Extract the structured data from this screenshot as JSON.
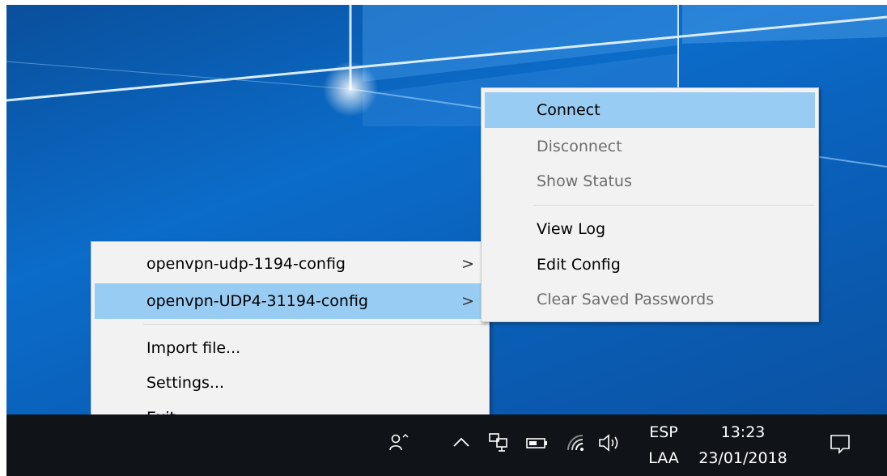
{
  "config_menu": {
    "items": [
      {
        "label": "openvpn-udp-1194-config",
        "has_submenu": true
      },
      {
        "label": "openvpn-UDP4-31194-config",
        "has_submenu": true,
        "highlighted": true
      }
    ],
    "actions": [
      {
        "label": "Import file..."
      },
      {
        "label": "Settings..."
      },
      {
        "label": "Exit"
      }
    ],
    "submenu_arrow": ">"
  },
  "submenu": {
    "items": [
      {
        "label": "Connect",
        "enabled": true,
        "highlighted": true
      },
      {
        "label": "Disconnect",
        "enabled": false
      },
      {
        "label": "Show Status",
        "enabled": false
      },
      {
        "label": "View Log",
        "enabled": true
      },
      {
        "label": "Edit Config",
        "enabled": true
      },
      {
        "label": "Clear Saved Passwords",
        "enabled": false
      }
    ]
  },
  "taskbar": {
    "language_top": "ESP",
    "language_bottom": "LAA",
    "time": "13:23",
    "date": "23/01/2018",
    "icons": [
      "people-icon",
      "chevron-up-icon",
      "network-icon",
      "battery-icon",
      "wifi-icon",
      "volume-icon",
      "action-center-icon"
    ]
  },
  "colors": {
    "highlight": "#99ccf3",
    "menu_background": "#f2f2f2",
    "disabled_text": "#6d6d6d",
    "taskbar": "#101419"
  }
}
